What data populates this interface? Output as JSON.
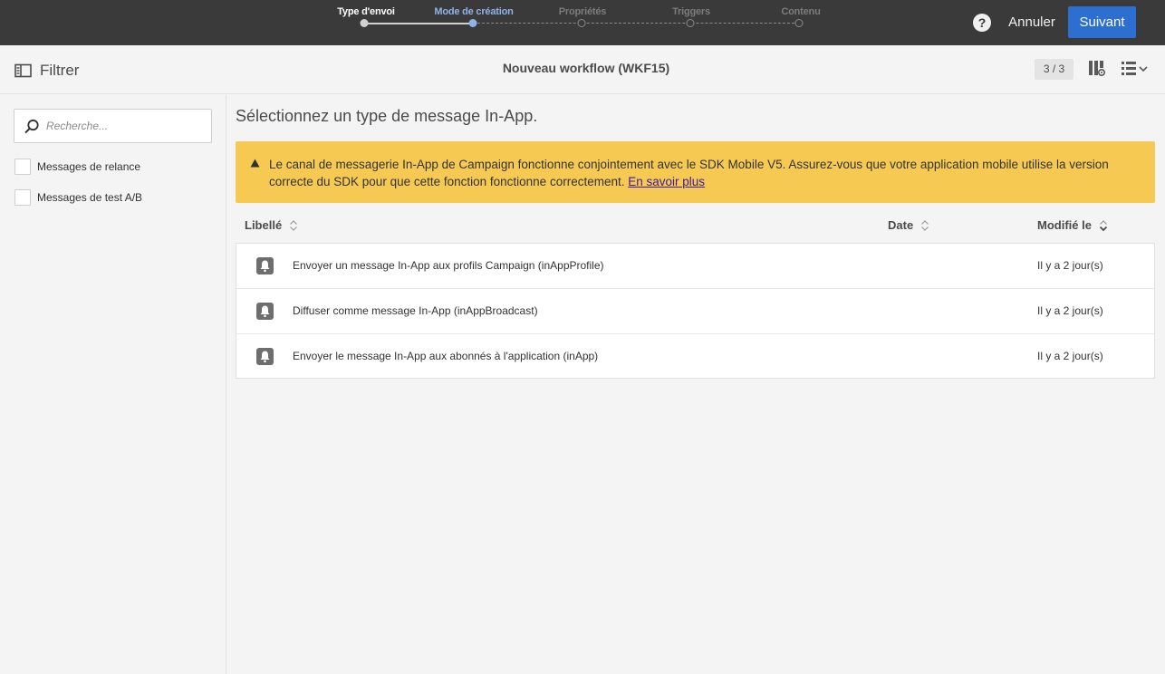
{
  "wizard": {
    "steps": [
      {
        "label": "Type d'envoi",
        "state": "done"
      },
      {
        "label": "Mode de création",
        "state": "active"
      },
      {
        "label": "Propriétés",
        "state": "todo"
      },
      {
        "label": "Triggers",
        "state": "todo"
      },
      {
        "label": "Contenu",
        "state": "todo"
      }
    ],
    "help_label": "?",
    "cancel_label": "Annuler",
    "next_label": "Suivant"
  },
  "subbar": {
    "filter_label": "Filtrer",
    "workflow_title": "Nouveau workflow (WKF15)",
    "counter": "3 / 3"
  },
  "sidebar": {
    "search_placeholder": "Recherche...",
    "filters": [
      {
        "label": "Messages de relance",
        "checked": false
      },
      {
        "label": "Messages de test A/B",
        "checked": false
      }
    ]
  },
  "main": {
    "title": "Sélectionnez un type de message In-App.",
    "alert_text": "Le canal de messagerie In-App de Campaign fonctionne conjointement avec le SDK Mobile V5. Assurez-vous que votre application mobile utilise la version correcte du SDK pour que cette fonction fonctionne correctement.",
    "alert_link": "En savoir plus",
    "columns": {
      "label": "Libellé",
      "date": "Date",
      "modified": "Modifié le"
    },
    "rows": [
      {
        "label": "Envoyer un message In-App aux profils Campaign (inAppProfile)",
        "date": "",
        "modified": "Il y a 2 jour(s)"
      },
      {
        "label": "Diffuser comme message In-App (inAppBroadcast)",
        "date": "",
        "modified": "Il y a 2 jour(s)"
      },
      {
        "label": "Envoyer le message In-App aux abonnés à l'application (inApp)",
        "date": "",
        "modified": "Il y a 2 jour(s)"
      }
    ]
  },
  "colors": {
    "topbar": "#3a3a3a",
    "accent": "#2d6fd0",
    "active_step": "#8fb3e8",
    "alert_bg": "#f6c952"
  }
}
